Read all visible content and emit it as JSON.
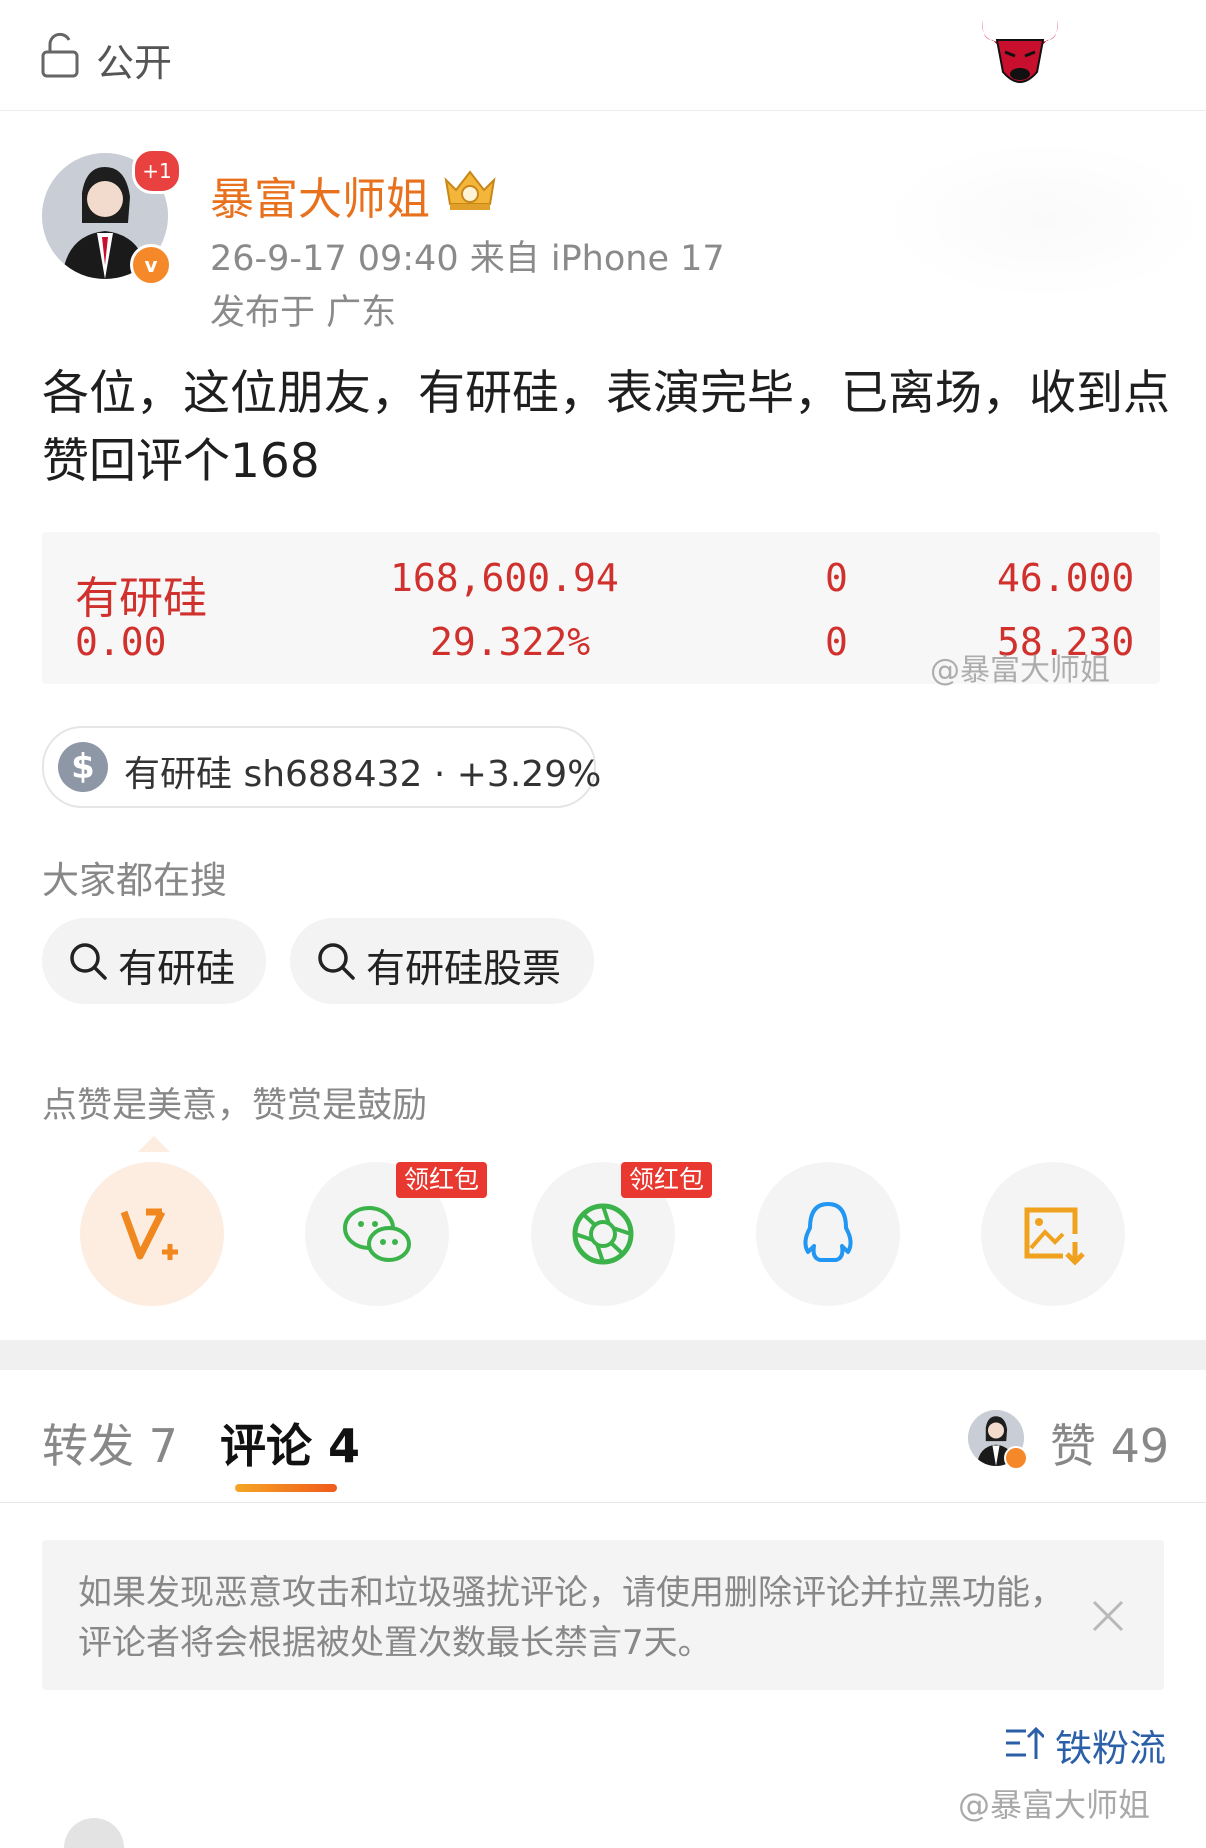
{
  "topbar": {
    "visibility_label": "公开"
  },
  "author": {
    "name": "暴富大师姐",
    "notification_badge": "+1",
    "verify_badge": "v",
    "meta": "26-9-17 09:40  来自 iPhone 17",
    "location": "发布于 广东"
  },
  "post": {
    "text": "各位，这位朋友，有研硅，表演完毕，已离场，收到点赞回评个168"
  },
  "quote": {
    "name": "有研硅",
    "row2_left": "0.00",
    "amount": "168,600.94",
    "percent": "29.322%",
    "zero1": "0",
    "zero2": "0",
    "price1": "46.000",
    "price2": "58.230",
    "watermark": "@暴富大师姐"
  },
  "stock_chip": {
    "symbol": "$",
    "text": "有研硅 sh688432 · +3.29%"
  },
  "search": {
    "heading": "大家都在搜",
    "items": [
      "有研硅",
      "有研硅股票"
    ]
  },
  "reward": {
    "text": "点赞是美意，赞赏是鼓励",
    "red_packet_label": "领红包",
    "share_icons": [
      "weibo-vplus-icon",
      "wechat-icon",
      "moments-icon",
      "qq-icon",
      "save-image-icon"
    ]
  },
  "tabs": {
    "repost": "转发 7",
    "comment": "评论 4",
    "like": "赞 49"
  },
  "notice": {
    "text": "如果发现恶意攻击和垃圾骚扰评论，请使用删除评论并拉黑功能，评论者将会根据被处置次数最长禁言7天。"
  },
  "sort": {
    "label": "铁粉流"
  },
  "watermark": "@暴富大师姐",
  "colors": {
    "accent": "#e8711d",
    "stock_red": "#d0312d",
    "link_blue": "#2b5fa8",
    "wechat_green": "#3cb34a",
    "qq_blue": "#2196f3",
    "red_packet": "#e8382f"
  }
}
